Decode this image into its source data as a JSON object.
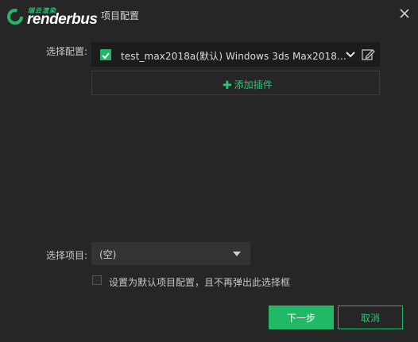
{
  "brand": {
    "name": "renderbus",
    "cn_tagline": "瑞云渲染",
    "accent": "#21b866"
  },
  "window": {
    "title": "项目配置"
  },
  "config": {
    "label": "选择配置:",
    "selected_text": "test_max2018a(默认)  Windows  3ds Max2018...",
    "checked": true
  },
  "add_plugin": {
    "label": "添加插件"
  },
  "project": {
    "label": "选择项目:",
    "value": "(空)"
  },
  "default_option": {
    "label": "设置为默认项目配置，且不再弹出此选择框",
    "checked": false
  },
  "buttons": {
    "next": "下一步",
    "cancel": "取消"
  },
  "icons": {
    "logo": "renderbus-logo-icon",
    "close": "close-icon",
    "check": "checkmark-icon",
    "chevron": "chevron-down-icon",
    "edit": "pencil-edit-icon",
    "plus": "plus-icon",
    "dropdown": "triangle-down-icon"
  }
}
